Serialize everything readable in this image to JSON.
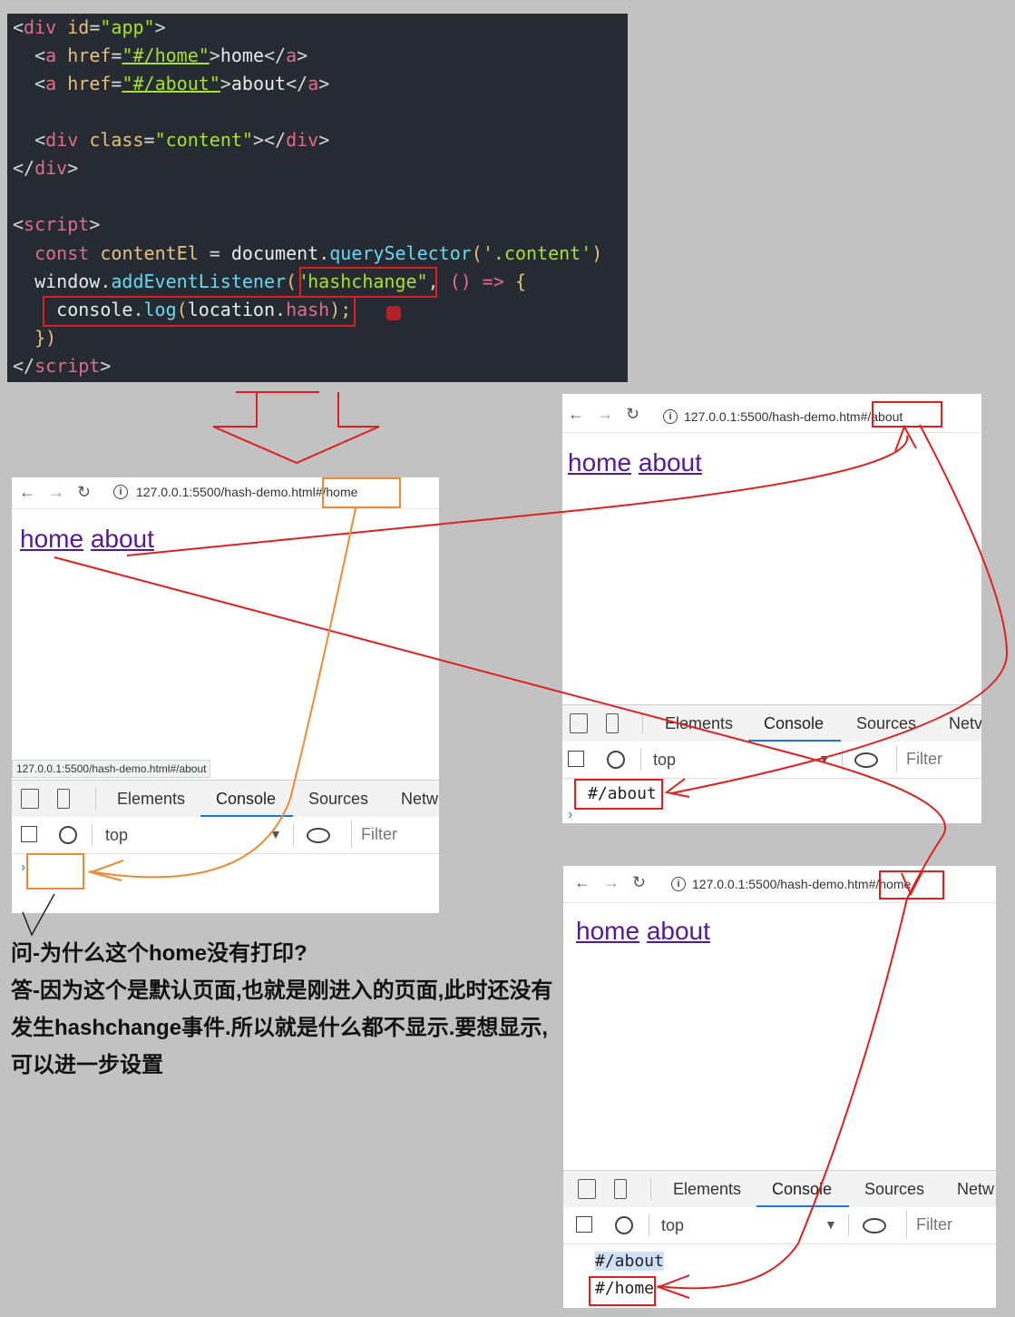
{
  "code": {
    "lines": [
      {
        "k": "l1"
      },
      {
        "k": "l2"
      },
      {
        "k": "l3"
      },
      {
        "k": "l4"
      },
      {
        "k": "l5"
      },
      {
        "k": "l6"
      },
      {
        "k": "l7"
      },
      {
        "k": "l8"
      },
      {
        "k": "l9"
      },
      {
        "k": "l10"
      },
      {
        "k": "l11"
      },
      {
        "k": "l12"
      }
    ],
    "t": {
      "div": "div",
      "id_attr": "id",
      "app_val": "\"app\"",
      "a": "a",
      "href": "href",
      "home_href": "\"#/home\"",
      "about_href": "\"#/about\"",
      "home": "home",
      "about": "about",
      "class_attr": "class",
      "content_val": "\"content\"",
      "script": "script",
      "const": "const",
      "contentEl": "contentEl",
      "document": "document",
      "querySelector": "querySelector",
      "sel": "'.content'",
      "window": "window",
      "addEventListener": "addEventListener",
      "hashchange": "\"hashchange\"",
      "arrow": "() =>",
      "console": "console",
      "log": "log",
      "location": "location",
      "hash": "hash"
    }
  },
  "windows": {
    "left": {
      "url_base": "127.0.0.1:5500/hash-demo.html",
      "url_hash": "#/home",
      "link_home": "home",
      "link_about": "about",
      "status_url": "127.0.0.1:5500/hash-demo.html#/about",
      "tabs": [
        "Elements",
        "Console",
        "Sources",
        "Netw"
      ],
      "context": "top",
      "filter": "Filter"
    },
    "right_top": {
      "url_base": "127.0.0.1:5500/hash-demo.htm",
      "url_hash": "#/about",
      "link_home": "home",
      "link_about": "about",
      "tabs": [
        "Elements",
        "Console",
        "Sources",
        "Netv"
      ],
      "context": "top",
      "filter": "Filter",
      "console_lines": [
        "#/about"
      ]
    },
    "right_bottom": {
      "url_base": "127.0.0.1:5500/hash-demo.htm",
      "url_hash": "#/home",
      "link_home": "home",
      "link_about": "about",
      "tabs": [
        "Elements",
        "Console",
        "Sources",
        "Netw"
      ],
      "context": "top",
      "filter": "Filter",
      "console_lines": [
        "#/about",
        "#/home"
      ]
    }
  },
  "qa": {
    "question": "问-为什么这个home没有打印?",
    "answer": "答-因为这个是默认页面,也就是刚进入的页面,此时还没有发生hashchange事件.所以就是什么都不显示.要想显示,可以进一步设置"
  },
  "colors": {
    "annotation_red": "#e02020",
    "annotation_orange": "#f08a30",
    "link_purple": "#55189b",
    "editor_bg": "#262a33"
  }
}
